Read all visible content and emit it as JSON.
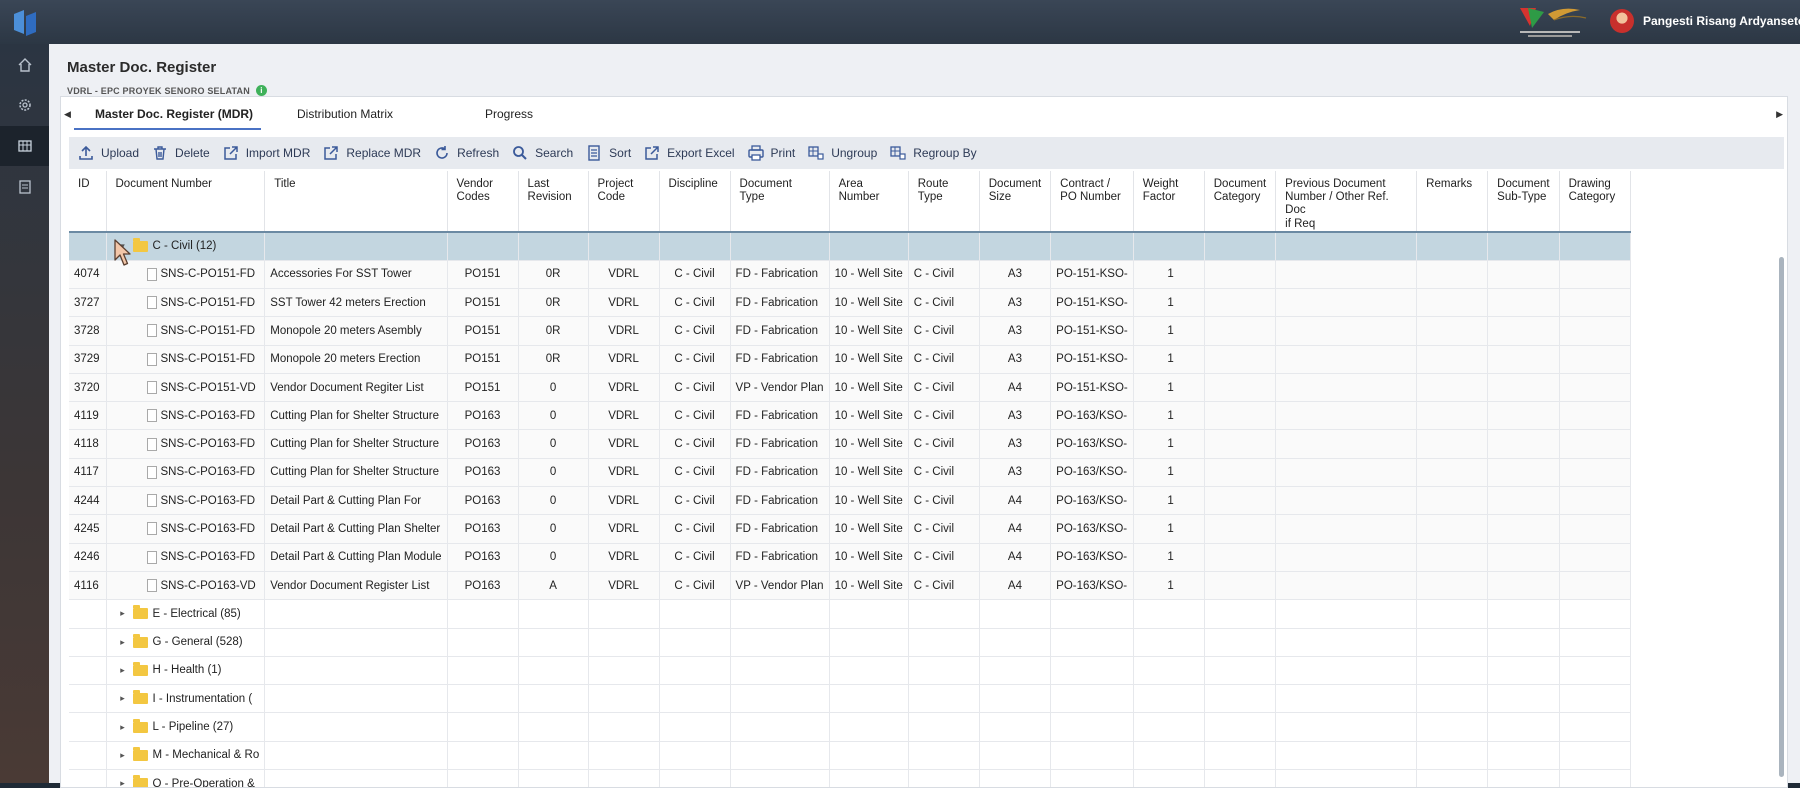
{
  "header": {
    "username": "Pangesti Risang Ardyanseto"
  },
  "sidebar": {
    "items": [
      "home-icon",
      "settings-icon",
      "dashboard-icon",
      "document-icon"
    ]
  },
  "page": {
    "title": "Master Doc. Register",
    "subtitle": "VDRL - EPC PROYEK SENORO SELATAN"
  },
  "tabs": [
    {
      "label": "Master Doc. Register (MDR)",
      "active": true
    },
    {
      "label": "Distribution Matrix",
      "active": false
    },
    {
      "label": "Progress",
      "active": false
    }
  ],
  "toolbar": {
    "upload": "Upload",
    "delete": "Delete",
    "import": "Import MDR",
    "replace": "Replace MDR",
    "refresh": "Refresh",
    "search": "Search",
    "sort": "Sort",
    "export": "Export Excel",
    "print": "Print",
    "ungroup": "Ungroup",
    "regroup": "Regroup By"
  },
  "columns": [
    [
      "ID"
    ],
    [
      "Document Number"
    ],
    [
      "Title"
    ],
    [
      "Vendor",
      "Codes"
    ],
    [
      "Last",
      "Revision"
    ],
    [
      "Project",
      "Code"
    ],
    [
      "Discipline"
    ],
    [
      "Document",
      "Type"
    ],
    [
      "Area",
      "Number"
    ],
    [
      "Route Type"
    ],
    [
      "Document",
      "Size"
    ],
    [
      "Contract /",
      "PO Number"
    ],
    [
      "Weight",
      "Factor"
    ],
    [
      "Document",
      "Category"
    ],
    [
      "Previous Document",
      "Number / Other Ref. Doc",
      "if Req"
    ],
    [
      "Remarks"
    ],
    [
      "Document",
      "Sub-Type"
    ],
    [
      "Drawing",
      "Category"
    ]
  ],
  "expanded_group": "C - Civil (12)",
  "rows": [
    [
      "4074",
      "SNS-C-PO151-FD",
      "Accessories For SST Tower",
      "PO151",
      "0R",
      "VDRL",
      "C - Civil",
      "FD - Fabrication",
      "10 - Well Site",
      "C - Civil",
      "A3",
      "PO-151-KSO-",
      "1"
    ],
    [
      "3727",
      "SNS-C-PO151-FD",
      "SST Tower 42 meters Erection",
      "PO151",
      "0R",
      "VDRL",
      "C - Civil",
      "FD - Fabrication",
      "10 - Well Site",
      "C - Civil",
      "A3",
      "PO-151-KSO-",
      "1"
    ],
    [
      "3728",
      "SNS-C-PO151-FD",
      "Monopole 20 meters Asembly",
      "PO151",
      "0R",
      "VDRL",
      "C - Civil",
      "FD - Fabrication",
      "10 - Well Site",
      "C - Civil",
      "A3",
      "PO-151-KSO-",
      "1"
    ],
    [
      "3729",
      "SNS-C-PO151-FD",
      "Monopole 20 meters Erection",
      "PO151",
      "0R",
      "VDRL",
      "C - Civil",
      "FD - Fabrication",
      "10 - Well Site",
      "C - Civil",
      "A3",
      "PO-151-KSO-",
      "1"
    ],
    [
      "3720",
      "SNS-C-PO151-VD",
      "Vendor Document Regiter List",
      "PO151",
      "0",
      "VDRL",
      "C - Civil",
      "VP - Vendor Plan",
      "10 - Well Site",
      "C - Civil",
      "A4",
      "PO-151-KSO-",
      "1"
    ],
    [
      "4119",
      "SNS-C-PO163-FD",
      "Cutting Plan for Shelter Structure",
      "PO163",
      "0",
      "VDRL",
      "C - Civil",
      "FD - Fabrication",
      "10 - Well Site",
      "C - Civil",
      "A3",
      "PO-163/KSO-",
      "1"
    ],
    [
      "4118",
      "SNS-C-PO163-FD",
      "Cutting Plan for Shelter Structure",
      "PO163",
      "0",
      "VDRL",
      "C - Civil",
      "FD - Fabrication",
      "10 - Well Site",
      "C - Civil",
      "A3",
      "PO-163/KSO-",
      "1"
    ],
    [
      "4117",
      "SNS-C-PO163-FD",
      "Cutting Plan for Shelter Structure",
      "PO163",
      "0",
      "VDRL",
      "C - Civil",
      "FD - Fabrication",
      "10 - Well Site",
      "C - Civil",
      "A3",
      "PO-163/KSO-",
      "1"
    ],
    [
      "4244",
      "SNS-C-PO163-FD",
      "Detail Part & Cutting Plan For",
      "PO163",
      "0",
      "VDRL",
      "C - Civil",
      "FD - Fabrication",
      "10 - Well Site",
      "C - Civil",
      "A4",
      "PO-163/KSO-",
      "1"
    ],
    [
      "4245",
      "SNS-C-PO163-FD",
      "Detail Part & Cutting Plan Shelter",
      "PO163",
      "0",
      "VDRL",
      "C - Civil",
      "FD - Fabrication",
      "10 - Well Site",
      "C - Civil",
      "A4",
      "PO-163/KSO-",
      "1"
    ],
    [
      "4246",
      "SNS-C-PO163-FD",
      "Detail Part & Cutting Plan Module",
      "PO163",
      "0",
      "VDRL",
      "C - Civil",
      "FD - Fabrication",
      "10 - Well Site",
      "C - Civil",
      "A4",
      "PO-163/KSO-",
      "1"
    ],
    [
      "4116",
      "SNS-C-PO163-VD",
      "Vendor Document Register List",
      "PO163",
      "A",
      "VDRL",
      "C - Civil",
      "VP - Vendor Plan",
      "10 - Well Site",
      "C - Civil",
      "A4",
      "PO-163/KSO-",
      "1"
    ]
  ],
  "collapsed_groups": [
    "E - Electrical (85)",
    "G - General (528)",
    "H - Health (1)",
    "I - Instrumentation (",
    "L - Pipeline (27)",
    "M - Mechanical & Ro",
    "O - Pre-Operation &"
  ]
}
